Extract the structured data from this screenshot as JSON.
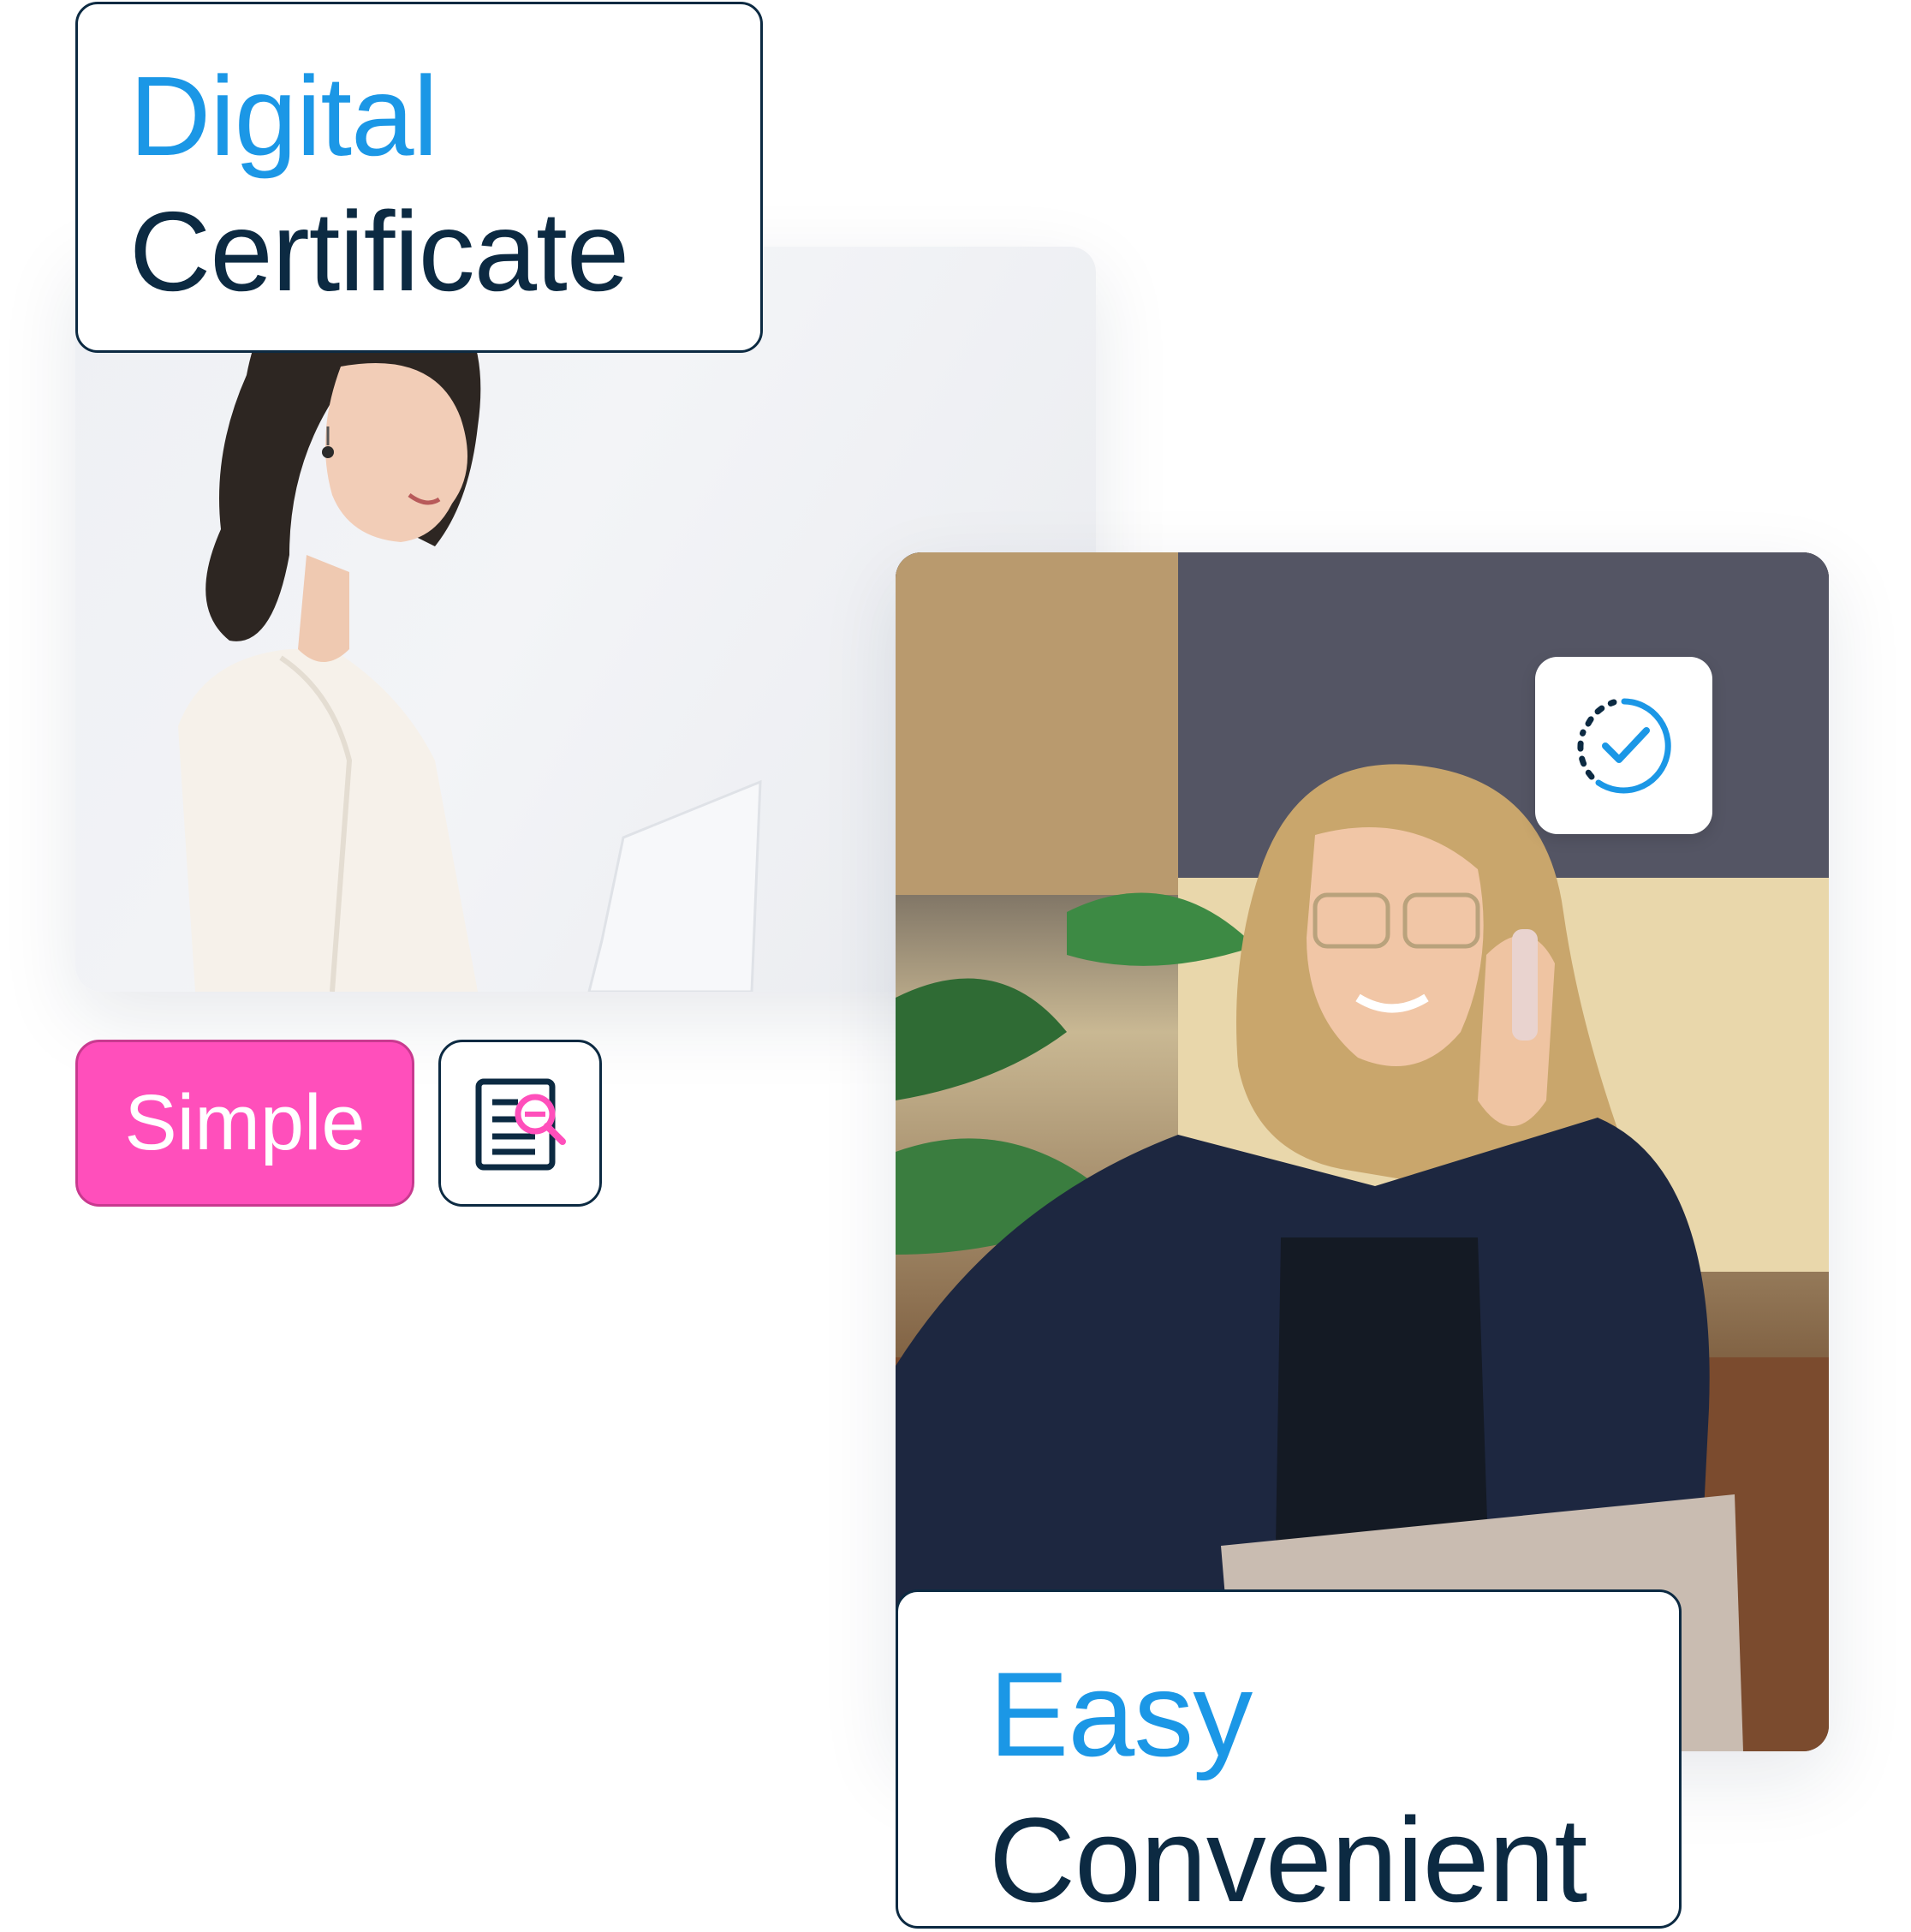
{
  "top_card": {
    "line1": "Digital",
    "line2": "Certificate"
  },
  "bottom_card": {
    "line1": "Easy",
    "line2": "Convenient"
  },
  "pill": {
    "label": "Simple"
  },
  "colors": {
    "accent_blue": "#1b97e6",
    "dark_navy": "#0c2a42",
    "pink": "#ff4fbb"
  },
  "icons": {
    "doc_tile": "document-search-icon",
    "check_tile": "check-progress-icon"
  },
  "photos": {
    "photo1": "woman-with-laptop-photo",
    "photo2": "woman-on-phone-photo"
  }
}
